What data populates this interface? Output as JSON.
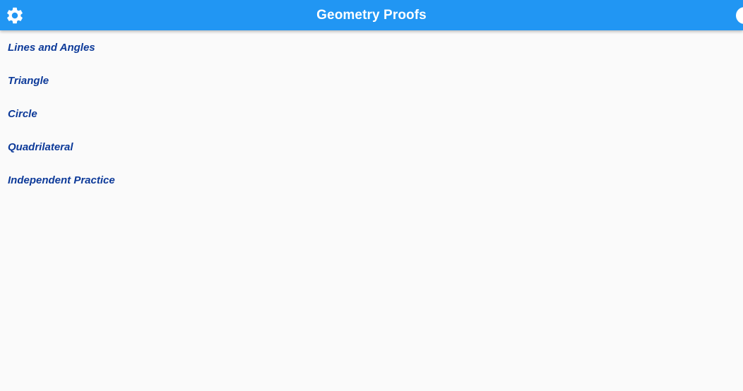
{
  "app": {
    "title": "Geometry Proofs",
    "accent_color": "#2196f3",
    "link_color": "#0d3a99",
    "background_color": "#fafafa"
  },
  "toolbar": {
    "left_icon": "gear-icon",
    "right_icon": "circle-icon"
  },
  "menu": {
    "items": [
      {
        "label": "Lines and Angles"
      },
      {
        "label": "Triangle"
      },
      {
        "label": "Circle"
      },
      {
        "label": "Quadrilateral"
      },
      {
        "label": "Independent Practice"
      }
    ]
  }
}
